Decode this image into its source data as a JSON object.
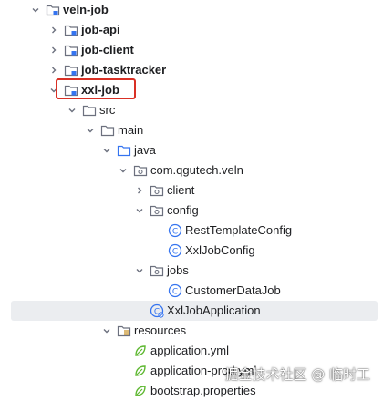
{
  "tree": {
    "root": "veln-job",
    "job_api": "job-api",
    "job_client": "job-client",
    "job_tasktracker": "job-tasktracker",
    "xxl_job": "xxl-job",
    "src": "src",
    "main": "main",
    "java": "java",
    "package": "com.qgutech.veln",
    "client": "client",
    "config": "config",
    "rest_template_config": "RestTemplateConfig",
    "xxl_job_config": "XxlJobConfig",
    "jobs": "jobs",
    "customer_data_job": "CustomerDataJob",
    "xxl_job_application": "XxlJobApplication",
    "resources": "resources",
    "application_yml": "application.yml",
    "application_prod_yml": "application-prod.yml",
    "bootstrap_properties": "bootstrap.properties"
  },
  "watermark": "掘金技术社区 @ 临时工",
  "colors": {
    "highlight_box": "#d93025",
    "selection": "#ebedf0",
    "class_icon": "#3574f0",
    "folder": "#6c707e"
  }
}
